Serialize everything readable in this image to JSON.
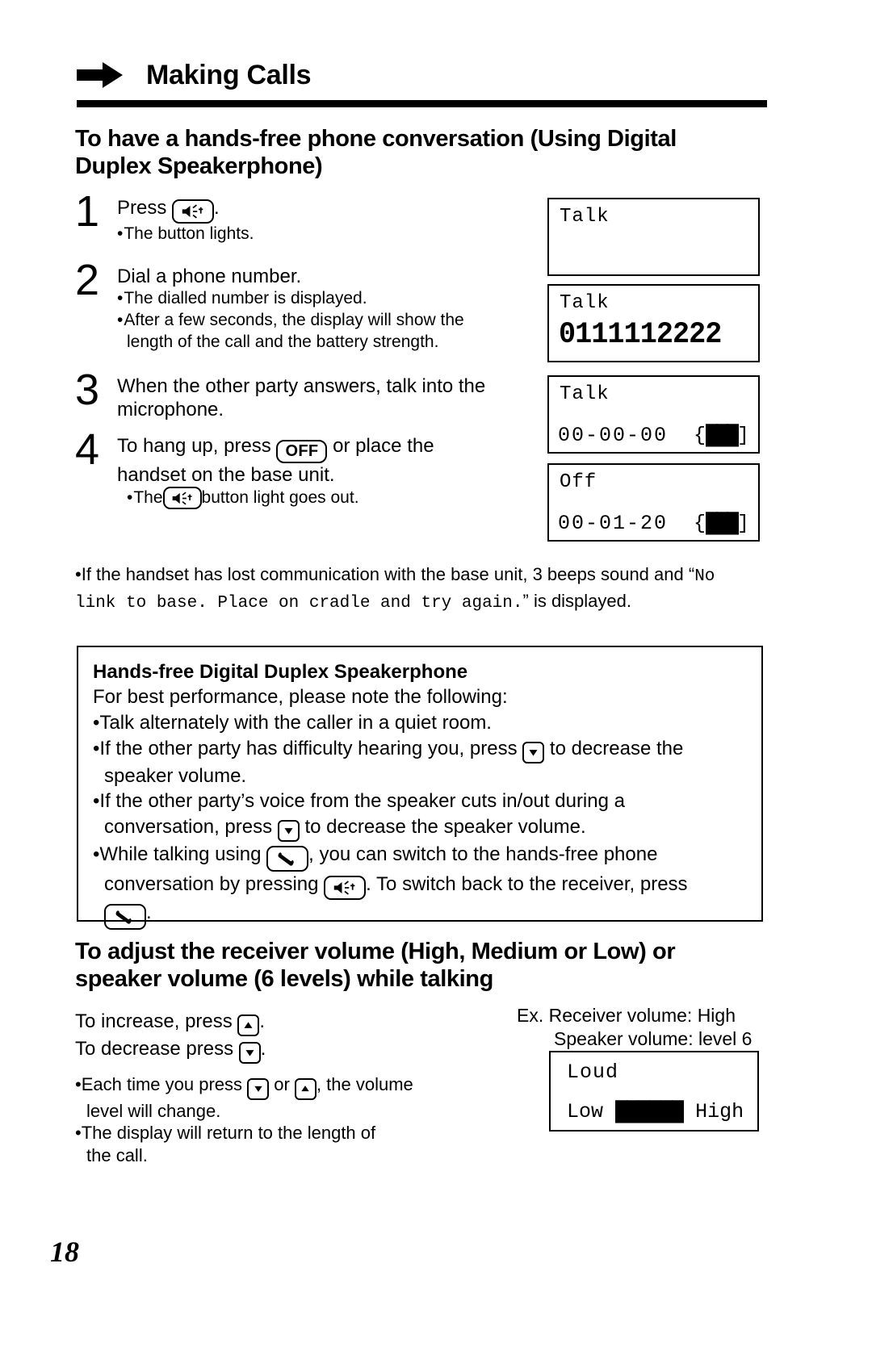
{
  "header": {
    "title": "Making Calls",
    "arrow_icon": "right-arrow-icon"
  },
  "section1": {
    "heading_line1": "To have a hands-free phone conversation (Using Digital",
    "heading_line2": "Duplex Speakerphone)"
  },
  "steps": [
    {
      "num": "1",
      "main_pre": "Press ",
      "main_post": ".",
      "icon": "speakerphone-key-icon",
      "bullets": [
        "The button lights."
      ]
    },
    {
      "num": "2",
      "main_pre": "Dial a phone number.",
      "main_post": "",
      "icon": "",
      "bullets": [
        "The dialled number is displayed.",
        "After a few seconds, the display will show the",
        "length of the call and the battery strength."
      ]
    },
    {
      "num": "3",
      "main_pre": "When the other party answers, talk into the",
      "main_post": "microphone.",
      "icon": "",
      "bullets": []
    },
    {
      "num": "4",
      "main_pre": "To hang up, press ",
      "main_mid": " or place the",
      "main_post": "handset on the base unit.",
      "icon": "off-key-icon",
      "off_label": "OFF",
      "bullet_pre": "The ",
      "bullet_post": " button light goes out.",
      "bullet_icon": "speakerphone-key-icon"
    }
  ],
  "displays": [
    {
      "name": "lcd-talk-empty",
      "line1": "Talk",
      "bignum": "",
      "line2": "",
      "batt": ""
    },
    {
      "name": "lcd-talk-number",
      "line1": "Talk",
      "bignum": "0111112222",
      "line2": "",
      "batt": ""
    },
    {
      "name": "lcd-talk-timer",
      "line1": "Talk",
      "bignum": "",
      "line2": "00-00-00",
      "batt_open": "{",
      "batt_bars": "███",
      "batt_close": "]"
    },
    {
      "name": "lcd-off-timer",
      "line1": "Off",
      "bignum": "",
      "line2": "00-01-20",
      "batt_open": "{",
      "batt_bars": "███",
      "batt_close": "]"
    }
  ],
  "note": {
    "bullet": "•",
    "part1": "If the handset has lost communication with the base unit, 3 beeps sound and “",
    "mono1": "No",
    "mono2": "link to base. Place on cradle and try again.",
    "part2": "” is displayed."
  },
  "tipbox": {
    "title": "Hands-free Digital Duplex Speakerphone",
    "intro": "For best performance, please note the following:",
    "bullets": [
      {
        "text": "Talk alternately with the caller in a quiet room."
      },
      {
        "pre": "If the other party has difficulty hearing you, press ",
        "icon": "volume-down-key-icon",
        "post": " to decrease the",
        "cont": "speaker volume."
      },
      {
        "pre": "If the other party’s voice from the speaker cuts in/out during a",
        "cont_pre": "conversation, press ",
        "icon": "volume-down-key-icon",
        "cont_post": " to decrease the speaker volume."
      },
      {
        "pre": "While talking using ",
        "icon": "handset-key-icon",
        "post": ", you can switch to the hands-free phone",
        "cont_pre": "conversation by pressing ",
        "icon2": "speakerphone-key-icon",
        "cont_post": ". To switch back to the receiver, press",
        "icon3": "handset-key-icon",
        "cont_end": "."
      }
    ]
  },
  "section2": {
    "heading_line1": "To adjust the receiver volume (High, Medium or Low) or",
    "heading_line2": "speaker volume (6 levels) while talking"
  },
  "volume": {
    "increase_pre": "To increase, press ",
    "increase_icon": "volume-up-key-icon",
    "increase_post": ".",
    "decrease_pre": "To decrease press ",
    "decrease_icon": "volume-down-key-icon",
    "decrease_post": ".",
    "bullet1_pre": "Each time you press ",
    "bullet1_icon1": "volume-down-key-icon",
    "bullet1_mid": " or ",
    "bullet1_icon2": "volume-up-key-icon",
    "bullet1_post": ", the volume",
    "bullet1_cont": "level will change.",
    "bullet2": "The display will return to the length of",
    "bullet2_cont": "the call.",
    "ex_line1": "Ex. Receiver volume: High",
    "ex_line2": "Speaker volume: level 6",
    "lcd_loud": "Loud",
    "lcd_low": "Low",
    "lcd_bars": "██████",
    "lcd_high": "High"
  },
  "page_number": "18",
  "colors": {
    "ink": "#000000",
    "paper": "#ffffff"
  }
}
